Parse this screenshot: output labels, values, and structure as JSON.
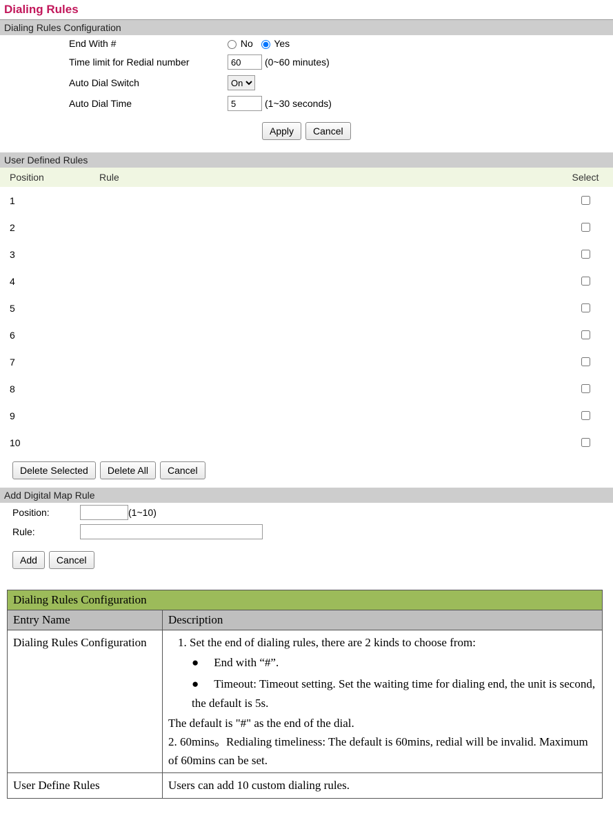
{
  "title": "Dialing Rules",
  "config": {
    "section": "Dialing Rules Configuration",
    "endWith": {
      "label": "End With #",
      "no": "No",
      "yes": "Yes",
      "value": "Yes"
    },
    "timeLimit": {
      "label": "Time limit for Redial number",
      "value": "60",
      "hint": "(0~60 minutes)"
    },
    "autoDialSwitch": {
      "label": "Auto Dial Switch",
      "options": [
        "On"
      ],
      "value": "On"
    },
    "autoDialTime": {
      "label": "Auto Dial Time",
      "value": "5",
      "hint": "(1~30 seconds)"
    },
    "apply": "Apply",
    "cancel": "Cancel"
  },
  "udr": {
    "section": "User Defined Rules",
    "headers": {
      "position": "Position",
      "rule": "Rule",
      "select": "Select"
    },
    "rows": [
      {
        "pos": "1"
      },
      {
        "pos": "2"
      },
      {
        "pos": "3"
      },
      {
        "pos": "4"
      },
      {
        "pos": "5"
      },
      {
        "pos": "6"
      },
      {
        "pos": "7"
      },
      {
        "pos": "8"
      },
      {
        "pos": "9"
      },
      {
        "pos": "10"
      }
    ],
    "deleteSelected": "Delete Selected",
    "deleteAll": "Delete All",
    "cancel": "Cancel"
  },
  "addRule": {
    "section": "Add Digital Map Rule",
    "positionLabel": "Position:",
    "positionHint": "(1~10)",
    "ruleLabel": "Rule:",
    "positionValue": "",
    "ruleValue": "",
    "add": "Add",
    "cancel": "Cancel"
  },
  "help": {
    "title": "Dialing Rules Configuration",
    "colEntry": "Entry Name",
    "colDesc": "Description",
    "rows": [
      {
        "entry": "Dialing Rules Configuration",
        "line1": "1. Set the end of dialing rules, there are 2 kinds to choose from:",
        "b1": "End with “#”.",
        "b2": "Timeout: Timeout setting. Set the waiting time for dialing end, the unit is second, the default is 5s.",
        "line2": "The default is \"#\" as the end of the dial.",
        "line3": "2. 60mins。Redialing timeliness: The default is 60mins, redial will be invalid. Maximum of 60mins can be set."
      },
      {
        "entry": "User Define Rules",
        "desc": "Users can add 10 custom dialing rules."
      }
    ]
  }
}
